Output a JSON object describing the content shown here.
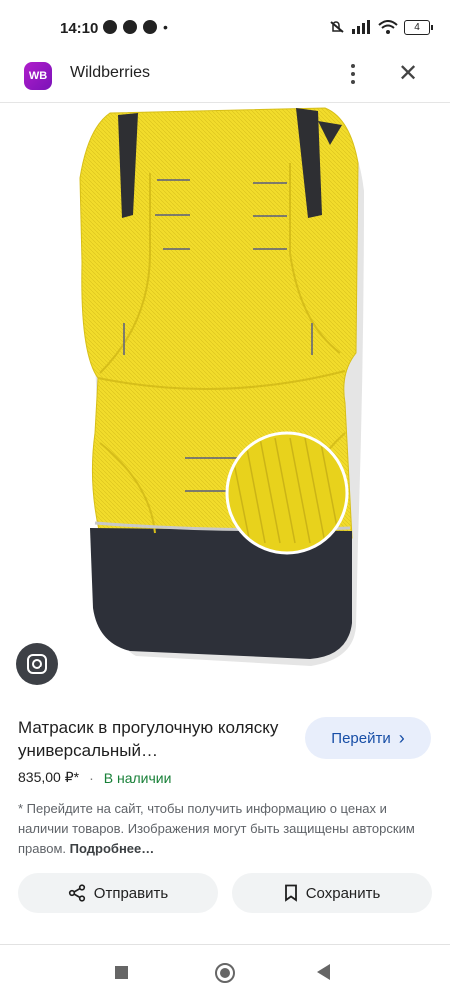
{
  "status": {
    "time": "14:10",
    "battery": "4"
  },
  "app": {
    "logo": "WB",
    "title": "Wildberries"
  },
  "product": {
    "title": "Матрасик в прогулочную коляску универсальный…",
    "price": "835,00 ₽*",
    "separator": "·",
    "stock": "В наличии",
    "go_label": "Перейти",
    "disclaimer": "* Перейдите на сайт, чтобы получить информацию о ценах и наличии товаров. Изображения могут быть защищены авторским правом.",
    "more_link": "Подробнее…"
  },
  "actions": {
    "share_label": "Отправить",
    "save_label": "Сохранить"
  },
  "colors": {
    "accent": "#174ea6",
    "stock": "#188038",
    "mattress_yellow": "#f2dc2b",
    "mattress_dark": "#2d3039"
  },
  "icons": [
    "whatsapp-icon",
    "chrome-icon",
    "mute-icon",
    "wifi-icon",
    "signal-icon",
    "more-vert-icon",
    "close-icon",
    "lens-icon",
    "chevron-right-icon",
    "share-icon",
    "bookmark-icon"
  ]
}
